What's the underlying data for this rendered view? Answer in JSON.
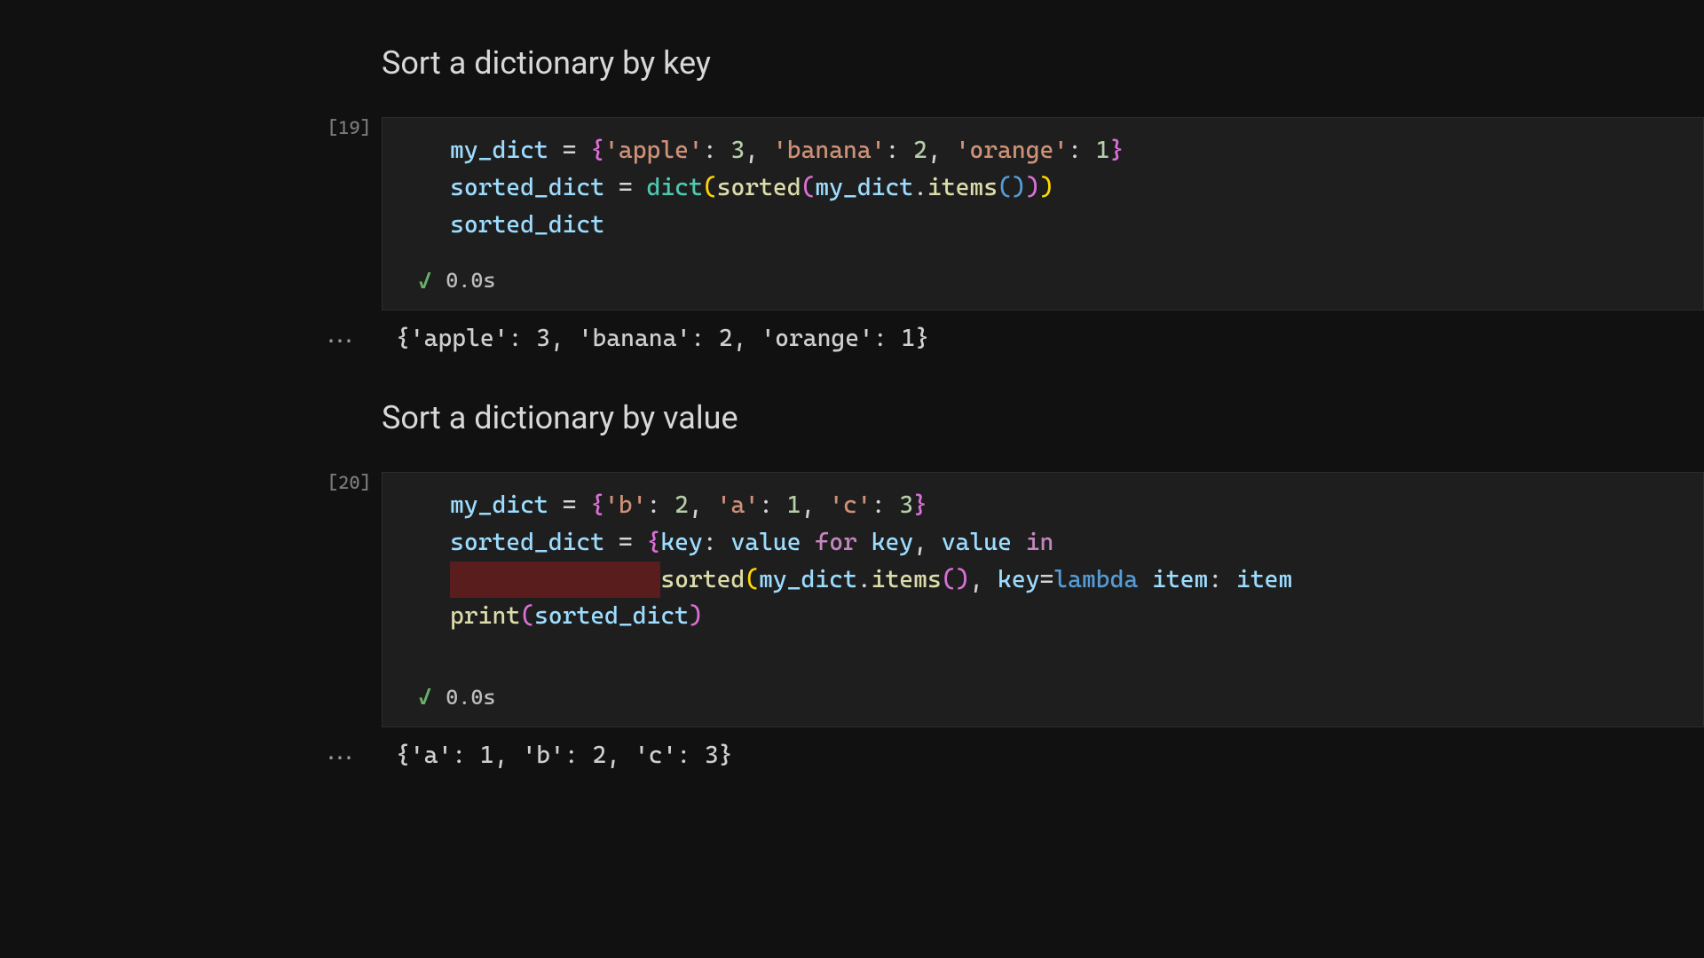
{
  "sections": [
    {
      "heading": "Sort a dictionary by key",
      "exec_count": "[19]",
      "exec_time": "0.0s",
      "output": "{'apple': 3, 'banana': 2, 'orange': 1}",
      "code_tokens": [
        [
          {
            "t": "my_dict",
            "c": "tk-ident"
          },
          {
            "t": " ",
            "c": ""
          },
          {
            "t": "=",
            "c": "tk-op"
          },
          {
            "t": " ",
            "c": ""
          },
          {
            "t": "{",
            "c": "tk-brace"
          },
          {
            "t": "'apple'",
            "c": "tk-str"
          },
          {
            "t": ": ",
            "c": "tk-punc"
          },
          {
            "t": "3",
            "c": "tk-num"
          },
          {
            "t": ", ",
            "c": "tk-punc"
          },
          {
            "t": "'banana'",
            "c": "tk-str"
          },
          {
            "t": ": ",
            "c": "tk-punc"
          },
          {
            "t": "2",
            "c": "tk-num"
          },
          {
            "t": ", ",
            "c": "tk-punc"
          },
          {
            "t": "'orange'",
            "c": "tk-str"
          },
          {
            "t": ": ",
            "c": "tk-punc"
          },
          {
            "t": "1",
            "c": "tk-num"
          },
          {
            "t": "}",
            "c": "tk-brace"
          }
        ],
        [
          {
            "t": "sorted_dict",
            "c": "tk-ident"
          },
          {
            "t": " ",
            "c": ""
          },
          {
            "t": "=",
            "c": "tk-op"
          },
          {
            "t": " ",
            "c": ""
          },
          {
            "t": "dict",
            "c": "tk-builtin"
          },
          {
            "t": "(",
            "c": "tk-paren"
          },
          {
            "t": "sorted",
            "c": "tk-func"
          },
          {
            "t": "(",
            "c": "tk-brace"
          },
          {
            "t": "my_dict",
            "c": "tk-ident"
          },
          {
            "t": ".",
            "c": "tk-punc"
          },
          {
            "t": "items",
            "c": "tk-func"
          },
          {
            "t": "(",
            "c": "tk-brace2"
          },
          {
            "t": ")",
            "c": "tk-brace2"
          },
          {
            "t": ")",
            "c": "tk-brace"
          },
          {
            "t": ")",
            "c": "tk-paren"
          }
        ],
        [
          {
            "t": "sorted_dict",
            "c": "tk-ident"
          }
        ]
      ]
    },
    {
      "heading": "Sort a dictionary by value",
      "exec_count": "[20]",
      "exec_time": "0.0s",
      "output": "{'a': 1, 'b': 2, 'c': 3}",
      "code_tokens": [
        [
          {
            "t": "my_dict",
            "c": "tk-ident"
          },
          {
            "t": " ",
            "c": ""
          },
          {
            "t": "=",
            "c": "tk-op"
          },
          {
            "t": " ",
            "c": ""
          },
          {
            "t": "{",
            "c": "tk-brace"
          },
          {
            "t": "'b'",
            "c": "tk-str"
          },
          {
            "t": ": ",
            "c": "tk-punc"
          },
          {
            "t": "2",
            "c": "tk-num"
          },
          {
            "t": ", ",
            "c": "tk-punc"
          },
          {
            "t": "'a'",
            "c": "tk-str"
          },
          {
            "t": ": ",
            "c": "tk-punc"
          },
          {
            "t": "1",
            "c": "tk-num"
          },
          {
            "t": ", ",
            "c": "tk-punc"
          },
          {
            "t": "'c'",
            "c": "tk-str"
          },
          {
            "t": ": ",
            "c": "tk-punc"
          },
          {
            "t": "3",
            "c": "tk-num"
          },
          {
            "t": "}",
            "c": "tk-brace"
          }
        ],
        [
          {
            "t": "sorted_dict",
            "c": "tk-ident"
          },
          {
            "t": " ",
            "c": ""
          },
          {
            "t": "=",
            "c": "tk-op"
          },
          {
            "t": " ",
            "c": ""
          },
          {
            "t": "{",
            "c": "tk-brace"
          },
          {
            "t": "key",
            "c": "tk-ident"
          },
          {
            "t": ": ",
            "c": "tk-punc"
          },
          {
            "t": "value",
            "c": "tk-ident"
          },
          {
            "t": " ",
            "c": ""
          },
          {
            "t": "for",
            "c": "tk-kw"
          },
          {
            "t": " ",
            "c": ""
          },
          {
            "t": "key",
            "c": "tk-ident"
          },
          {
            "t": ", ",
            "c": "tk-punc"
          },
          {
            "t": "value",
            "c": "tk-ident"
          },
          {
            "t": " ",
            "c": ""
          },
          {
            "t": "in",
            "c": "tk-kw"
          }
        ],
        [
          {
            "t": "               ",
            "c": "err-indent"
          },
          {
            "t": "sorted",
            "c": "tk-func"
          },
          {
            "t": "(",
            "c": "tk-paren"
          },
          {
            "t": "my_dict",
            "c": "tk-ident"
          },
          {
            "t": ".",
            "c": "tk-punc"
          },
          {
            "t": "items",
            "c": "tk-func"
          },
          {
            "t": "(",
            "c": "tk-brace"
          },
          {
            "t": ")",
            "c": "tk-brace"
          },
          {
            "t": ", ",
            "c": "tk-punc"
          },
          {
            "t": "key",
            "c": "tk-ident"
          },
          {
            "t": "=",
            "c": "tk-op"
          },
          {
            "t": "lambda",
            "c": "tk-blue"
          },
          {
            "t": " ",
            "c": ""
          },
          {
            "t": "item",
            "c": "tk-ident"
          },
          {
            "t": ": ",
            "c": "tk-punc"
          },
          {
            "t": "item",
            "c": "tk-ident"
          }
        ],
        [
          {
            "t": "print",
            "c": "tk-func"
          },
          {
            "t": "(",
            "c": "tk-brace"
          },
          {
            "t": "sorted_dict",
            "c": "tk-ident"
          },
          {
            "t": ")",
            "c": "tk-brace"
          }
        ]
      ]
    }
  ],
  "icons": {
    "check": "✓",
    "dots": "⋯"
  }
}
